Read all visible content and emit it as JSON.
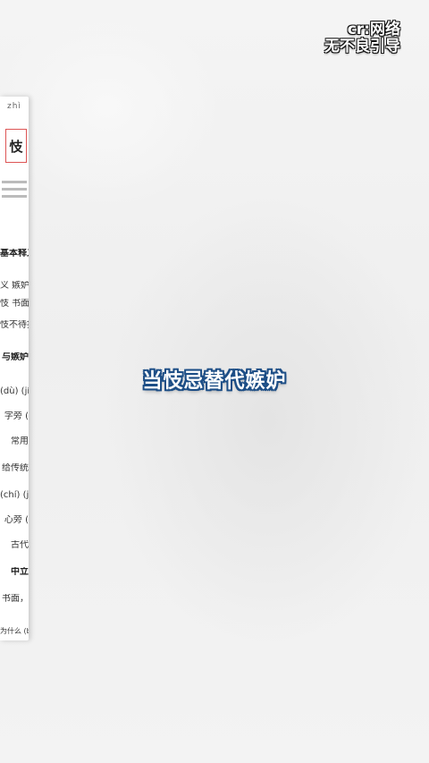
{
  "watermark": {
    "line1": "cr:网络",
    "line2": "无不良引导"
  },
  "caption": "当忮忌替代嫉妒",
  "document": {
    "pinyin": "zhì",
    "character": "忮",
    "section_heading": "基本释义",
    "rows": [
      "义 嫉妒，",
      "忮 书面 文",
      "忮不待指",
      "与嫉妒",
      "(dù) (jí",
      "字旁 (",
      "常用",
      "给传统",
      "(chí) (jì",
      "心旁 (",
      "古代",
      "中立",
      "书面，",
      "为什么 (bu)"
    ]
  }
}
